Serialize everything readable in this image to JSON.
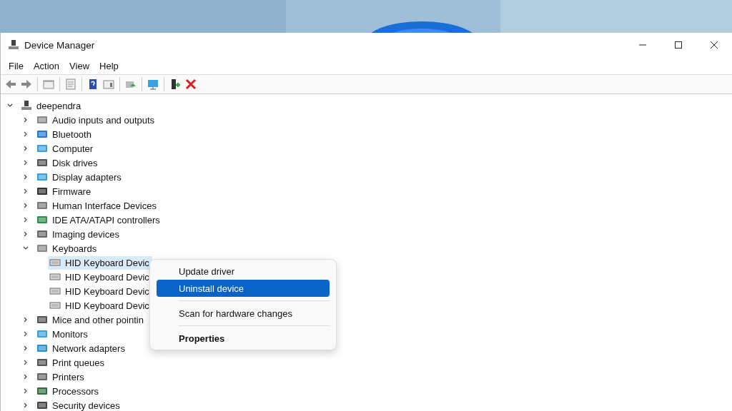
{
  "window": {
    "title": "Device Manager"
  },
  "menu_bar": [
    "File",
    "Action",
    "View",
    "Help"
  ],
  "tree": {
    "label": "deependra",
    "expanded": true,
    "children": [
      {
        "label": "Audio inputs and outputs",
        "expanded": false
      },
      {
        "label": "Bluetooth",
        "expanded": false
      },
      {
        "label": "Computer",
        "expanded": false
      },
      {
        "label": "Disk drives",
        "expanded": false
      },
      {
        "label": "Display adapters",
        "expanded": false
      },
      {
        "label": "Firmware",
        "expanded": false
      },
      {
        "label": "Human Interface Devices",
        "expanded": false
      },
      {
        "label": "IDE ATA/ATAPI controllers",
        "expanded": false
      },
      {
        "label": "Imaging devices",
        "expanded": false
      },
      {
        "label": "Keyboards",
        "expanded": true,
        "children": [
          {
            "label": "HID Keyboard Devic",
            "selected": true
          },
          {
            "label": "HID Keyboard Devic",
            "selected": false
          },
          {
            "label": "HID Keyboard Devic",
            "selected": false
          },
          {
            "label": "HID Keyboard Devic",
            "selected": false
          }
        ]
      },
      {
        "label": "Mice and other pointin",
        "expanded": false
      },
      {
        "label": "Monitors",
        "expanded": false
      },
      {
        "label": "Network adapters",
        "expanded": false
      },
      {
        "label": "Print queues",
        "expanded": false
      },
      {
        "label": "Printers",
        "expanded": false
      },
      {
        "label": "Processors",
        "expanded": false
      },
      {
        "label": "Security devices",
        "expanded": false
      }
    ]
  },
  "context_menu": [
    {
      "kind": "item",
      "label": "Update driver",
      "selected": false,
      "default": false
    },
    {
      "kind": "item",
      "label": "Uninstall device",
      "selected": true,
      "default": false
    },
    {
      "kind": "separator"
    },
    {
      "kind": "item",
      "label": "Scan for hardware changes",
      "selected": false,
      "default": false
    },
    {
      "kind": "separator"
    },
    {
      "kind": "item",
      "label": "Properties",
      "selected": false,
      "default": true
    }
  ]
}
